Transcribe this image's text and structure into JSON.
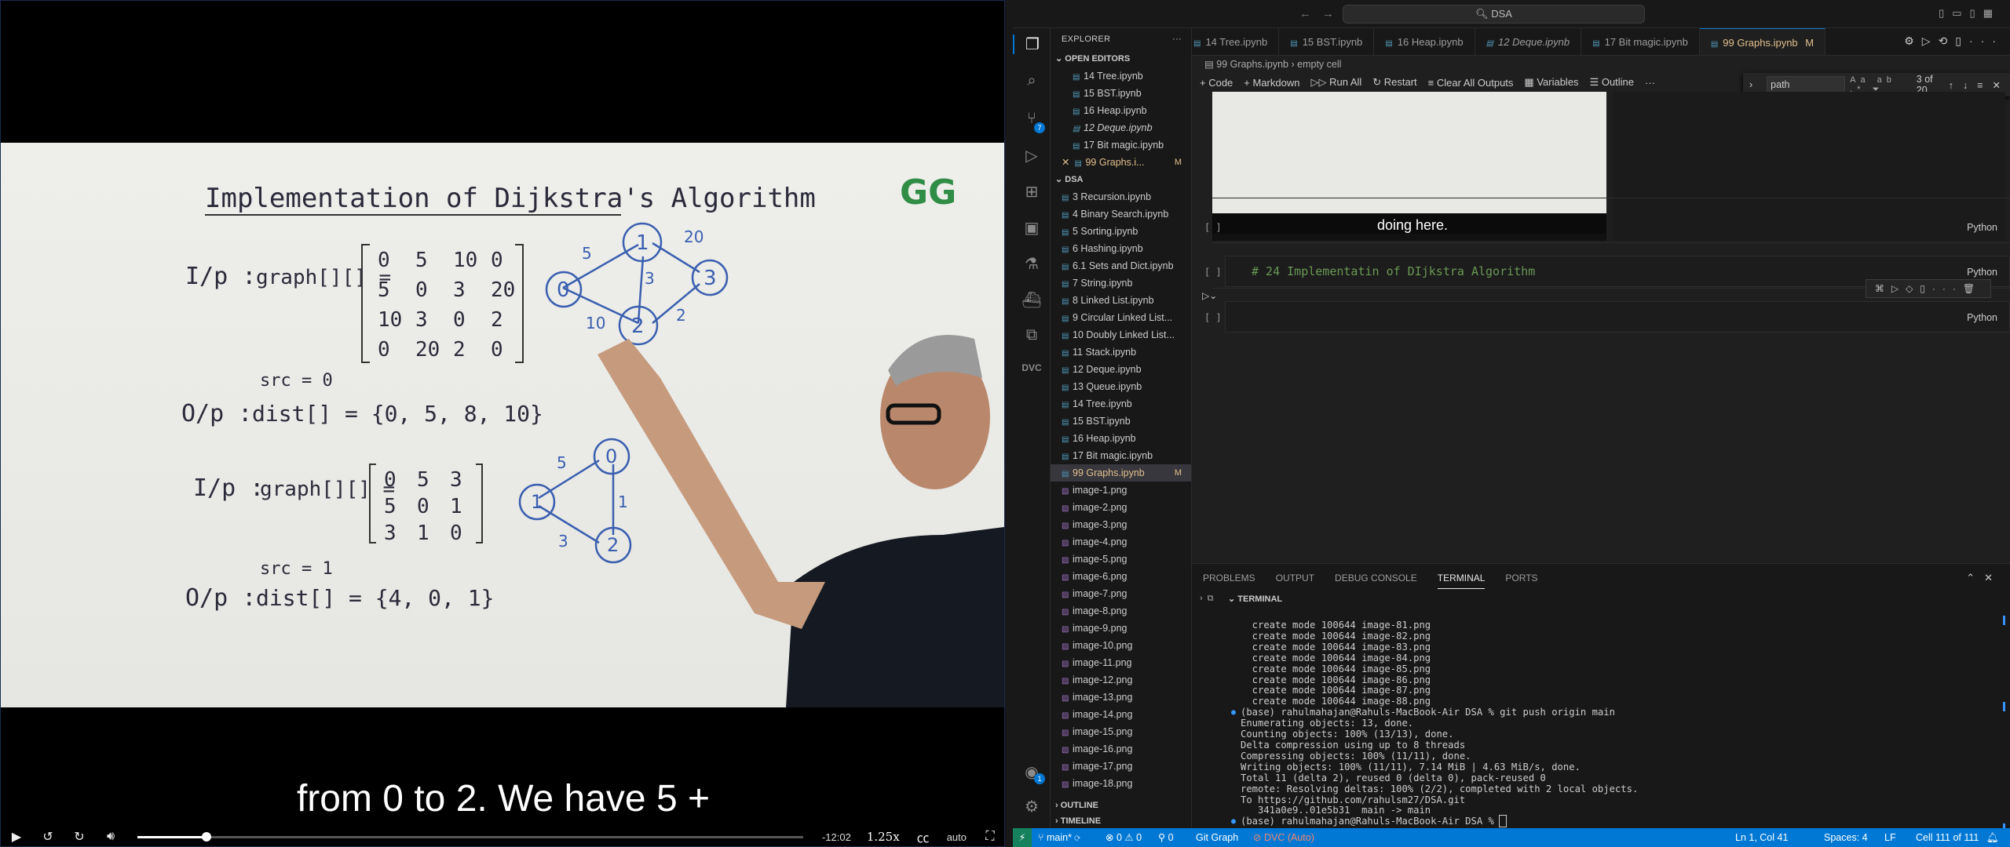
{
  "video": {
    "caption": "from 0 to 2. We have 5 +",
    "time_remaining": "-12:02",
    "speed": "1.25x",
    "quality": "auto",
    "progress": 0.104,
    "board": {
      "title": "Implementation of Dijkstra's Algorithm",
      "logo": "GG",
      "ex1_input_label": "I/p :",
      "ex1_input": "graph[][] =",
      "ex1_matrix": [
        [
          "0",
          "5",
          "10",
          "0"
        ],
        [
          "5",
          "0",
          "3",
          "20"
        ],
        [
          "10",
          "3",
          "0",
          "2"
        ],
        [
          "0",
          "20",
          "2",
          "0"
        ]
      ],
      "ex1_src": "src = 0",
      "ex1_output_label": "O/p :",
      "ex1_output": "dist[] = {0, 5, 8, 10}",
      "ex1_nodes": [
        "0",
        "1",
        "2",
        "3"
      ],
      "ex1_weights": [
        "5",
        "20",
        "3",
        "10",
        "2"
      ],
      "ex2_input_label": "I/p :",
      "ex2_input": "graph[][] =",
      "ex2_matrix": [
        [
          "0",
          "5",
          "3"
        ],
        [
          "5",
          "0",
          "1"
        ],
        [
          "3",
          "1",
          "0"
        ]
      ],
      "ex2_src": "src = 1",
      "ex2_output_label": "O/p :",
      "ex2_output": "dist[] = {4, 0, 1}",
      "ex2_nodes": [
        "0",
        "1",
        "2"
      ],
      "ex2_weights": [
        "5",
        "1",
        "3"
      ]
    }
  },
  "vscode": {
    "search_text": "DSA",
    "explorer_title": "EXPLORER",
    "open_editors_label": "OPEN EDITORS",
    "open_editors": [
      {
        "name": "14 Tree.ipynb",
        "italic": false,
        "mark": ""
      },
      {
        "name": "15 BST.ipynb",
        "italic": false,
        "mark": ""
      },
      {
        "name": "16 Heap.ipynb",
        "italic": false,
        "mark": ""
      },
      {
        "name": "12 Deque.ipynb",
        "italic": true,
        "mark": ""
      },
      {
        "name": "17 Bit magic.ipynb",
        "italic": false,
        "mark": ""
      },
      {
        "name": "99 Graphs.i...",
        "italic": false,
        "mark": "M"
      }
    ],
    "folder_label": "DSA",
    "files": [
      "3 Recursion.ipynb",
      "4 Binary Search.ipynb",
      "5 Sorting.ipynb",
      "6 Hashing.ipynb",
      "6.1 Sets and Dict.ipynb",
      "7 String.ipynb",
      "8 Linked List.ipynb",
      "9 Circular Linked List...",
      "10 Doubly Linked List...",
      "11 Stack.ipynb",
      "12 Deque.ipynb",
      "13 Queue.ipynb",
      "14 Tree.ipynb",
      "15 BST.ipynb",
      "16 Heap.ipynb",
      "17 Bit magic.ipynb"
    ],
    "selected_file": "99 Graphs.ipynb",
    "selected_mark": "M",
    "images": [
      "image-1.png",
      "image-2.png",
      "image-3.png",
      "image-4.png",
      "image-5.png",
      "image-6.png",
      "image-7.png",
      "image-8.png",
      "image-9.png",
      "image-10.png",
      "image-11.png",
      "image-12.png",
      "image-13.png",
      "image-14.png",
      "image-15.png",
      "image-16.png",
      "image-17.png",
      "image-18.png"
    ],
    "outline_label": "OUTLINE",
    "timeline_label": "TIMELINE",
    "tabs": [
      {
        "name": "14 Tree.ipynb",
        "active": false,
        "italic": false
      },
      {
        "name": "15 BST.ipynb",
        "active": false,
        "italic": false
      },
      {
        "name": "16 Heap.ipynb",
        "active": false,
        "italic": false
      },
      {
        "name": "12 Deque.ipynb",
        "active": false,
        "italic": true
      },
      {
        "name": "17 Bit magic.ipynb",
        "active": false,
        "italic": false
      },
      {
        "name": "99 Graphs.ipynb",
        "active": true,
        "italic": false,
        "mark": "M"
      }
    ],
    "breadcrumb": [
      "99 Graphs.ipynb",
      "empty cell"
    ],
    "toolbar": [
      "+ Code",
      "+ Markdown",
      "Run All",
      "Restart",
      "Clear All Outputs",
      "Variables",
      "Outline",
      "···"
    ],
    "find": {
      "value": "path",
      "count": "3 of 20"
    },
    "output_caption": "doing here.",
    "cells": [
      {
        "num": "[ ]",
        "lang": "Python",
        "code": ""
      },
      {
        "num": "[ ]",
        "lang": "Python",
        "code": "# 24 Implementatin of DIjkstra Algorithm"
      },
      {
        "num": "[ ]",
        "lang": "Python",
        "code": ""
      }
    ],
    "panel_tabs": [
      "PROBLEMS",
      "OUTPUT",
      "DEBUG CONSOLE",
      "TERMINAL",
      "PORTS"
    ],
    "terminal_label": "TERMINAL",
    "terminal_lines": [
      "  create mode 100644 image-81.png",
      "  create mode 100644 image-82.png",
      "  create mode 100644 image-83.png",
      "  create mode 100644 image-84.png",
      "  create mode 100644 image-85.png",
      "  create mode 100644 image-86.png",
      "  create mode 100644 image-87.png",
      "  create mode 100644 image-88.png",
      "(base) rahulmahajan@Rahuls-MacBook-Air DSA % git push origin main",
      "Enumerating objects: 13, done.",
      "Counting objects: 100% (13/13), done.",
      "Delta compression using up to 8 threads",
      "Compressing objects: 100% (11/11), done.",
      "Writing objects: 100% (11/11), 7.14 MiB | 4.63 MiB/s, done.",
      "Total 11 (delta 2), reused 0 (delta 0), pack-reused 0",
      "remote: Resolving deltas: 100% (2/2), completed with 2 local objects.",
      "To https://github.com/rahulsm27/DSA.git",
      "   341a0e9..01e5b31  main -> main",
      "(base) rahulmahajan@Rahuls-MacBook-Air DSA % "
    ],
    "status": {
      "branch": "main*",
      "errors": "0",
      "warnings": "0",
      "ports": "0",
      "git_graph": "Git Graph",
      "dvc": "DVC (Auto)",
      "position": "Ln 1, Col 41",
      "spaces": "Spaces: 4",
      "eol": "LF",
      "cell": "Cell 111 of 111"
    },
    "activity_badges": {
      "scm": "7",
      "account": "1"
    }
  }
}
